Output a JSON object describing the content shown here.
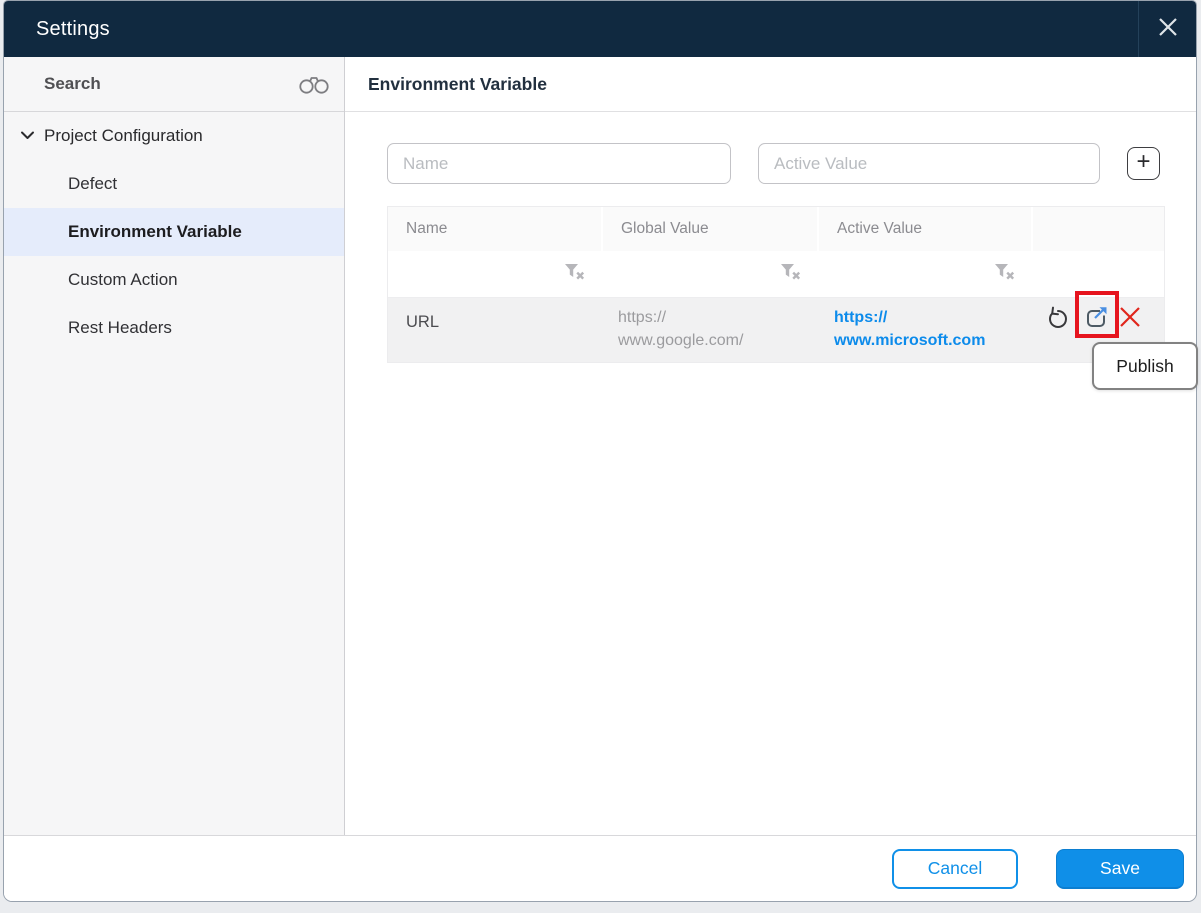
{
  "dialog": {
    "title": "Settings"
  },
  "sidebar": {
    "search_label": "Search",
    "sections": [
      {
        "label": "Project Configuration",
        "expanded": true,
        "children": [
          {
            "label": "Defect",
            "selected": false
          },
          {
            "label": "Environment Variable",
            "selected": true
          },
          {
            "label": "Custom Action",
            "selected": false
          },
          {
            "label": "Rest Headers",
            "selected": false
          }
        ]
      }
    ]
  },
  "main": {
    "title": "Environment Variable",
    "name_input": {
      "value": "",
      "placeholder": "Name"
    },
    "active_value_input": {
      "value": "",
      "placeholder": "Active Value"
    },
    "add_button_label": "+",
    "table": {
      "headers": [
        "Name",
        "Global Value",
        "Active Value"
      ],
      "rows": [
        {
          "name": "URL",
          "global_value": "https://\nwww.google.com/",
          "active_value": "https://\nwww.microsoft.com",
          "actions": [
            "revert",
            "publish",
            "delete"
          ]
        }
      ]
    },
    "tooltip_label": "Publish",
    "highlight": {
      "target": "publish-icon",
      "color": "#e6141e"
    }
  },
  "footer": {
    "cancel_label": "Cancel",
    "save_label": "Save"
  },
  "icons": {
    "close": "close-icon",
    "search": "binoculars-icon",
    "expand": "chevron-down-icon",
    "add": "plus-icon",
    "filter": "filter-clear-icon",
    "revert": "revert-icon",
    "publish": "publish-icon",
    "delete": "delete-x-icon"
  },
  "colors": {
    "header_bg": "#102940",
    "accent_blue": "#1090e8",
    "link_blue": "#0c8beb",
    "selected_item_bg": "#e5ecfb",
    "danger_red": "#e0261c",
    "highlight_red": "#e6141e",
    "sidebar_bg": "#f6f6f7",
    "row_bg": "#f1f1f2"
  }
}
